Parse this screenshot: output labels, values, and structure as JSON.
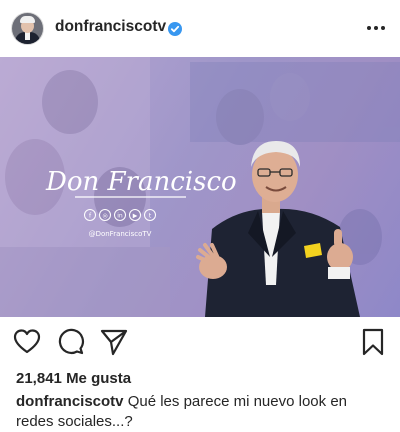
{
  "header": {
    "username": "donfranciscotv",
    "verified": true
  },
  "post": {
    "logo_text": "Don Francisco",
    "handle": "@DonFranciscoTV",
    "social_icons": [
      "facebook-icon",
      "instagram-icon",
      "linkedin-icon",
      "youtube-icon",
      "twitter-icon"
    ]
  },
  "actions": {
    "icons": [
      "heart-icon",
      "comment-icon",
      "share-icon",
      "bookmark-icon"
    ]
  },
  "likes": {
    "count": "21,841",
    "label": "Me gusta"
  },
  "caption": {
    "username": "donfranciscotv",
    "text": "Qué les parece mi nuevo look en redes sociales...?"
  },
  "colors": {
    "verified_blue": "#3897f0",
    "text": "#262626",
    "post_purple": "#a08fc4"
  }
}
